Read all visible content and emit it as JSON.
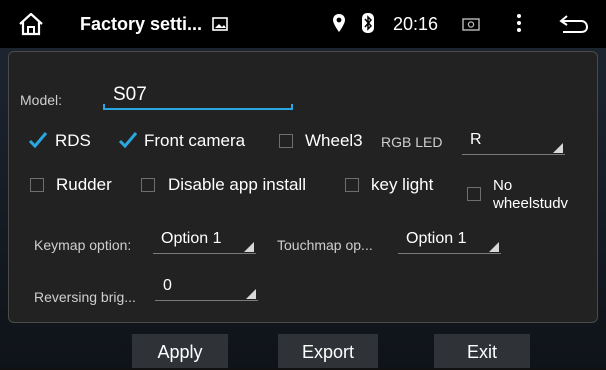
{
  "status_bar": {
    "title": "Factory setti...",
    "time": "20:16",
    "icons": [
      "home-icon",
      "image-icon",
      "location-icon",
      "bluetooth-icon",
      "screenshot-icon",
      "more-vert-icon",
      "back-icon"
    ]
  },
  "form": {
    "model": {
      "label": "Model:",
      "value": "S07"
    },
    "options_row1": [
      {
        "label": "RDS",
        "checked": true
      },
      {
        "label": "Front camera",
        "checked": true
      },
      {
        "label": "Wheel3",
        "checked": false
      }
    ],
    "rgb_led": {
      "label": "RGB LED",
      "value": "R"
    },
    "options_row2": [
      {
        "label": "Rudder",
        "checked": false
      },
      {
        "label": "Disable app install",
        "checked": false
      },
      {
        "label": "key light",
        "checked": false
      },
      {
        "label": "No wheelstudv",
        "checked": false
      }
    ],
    "keymap": {
      "label": "Keymap option:",
      "value": "Option 1"
    },
    "touchmap": {
      "label": "Touchmap op...",
      "value": "Option 1"
    },
    "reversing": {
      "label": "Reversing brig...",
      "value": "0"
    }
  },
  "buttons": {
    "apply": "Apply",
    "export": "Export",
    "exit": "Exit"
  },
  "colors": {
    "accent": "#2aa6e0",
    "panel": "#222222",
    "topbar": "#000000",
    "button": "#2f3338"
  }
}
